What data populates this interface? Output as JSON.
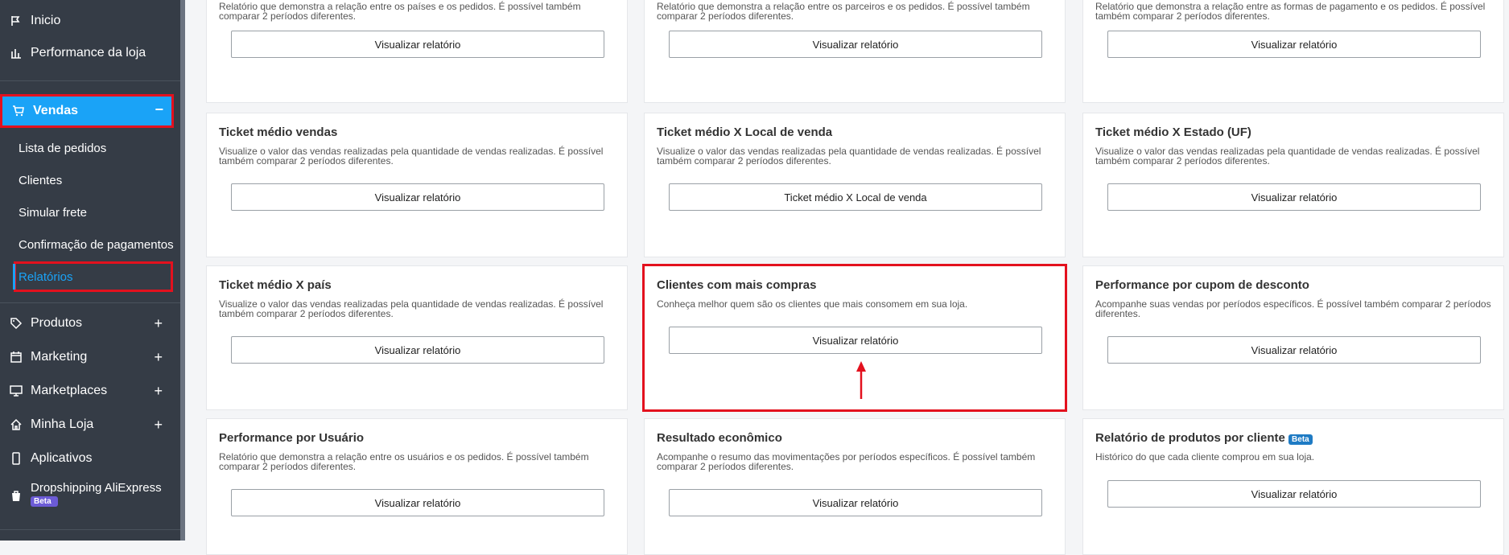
{
  "sidebar": {
    "items": [
      {
        "label": "Inicio",
        "icon": "flag-icon"
      },
      {
        "label": "Performance da loja",
        "icon": "bar-chart-icon"
      },
      {
        "label": "Vendas",
        "icon": "cart-icon",
        "expander": "−"
      },
      {
        "label": "Produtos",
        "icon": "tag-icon",
        "expander": "+"
      },
      {
        "label": "Marketing",
        "icon": "calendar-icon",
        "expander": "+"
      },
      {
        "label": "Marketplaces",
        "icon": "monitor-icon",
        "expander": "+"
      },
      {
        "label": "Minha Loja",
        "icon": "home-icon",
        "expander": "+"
      },
      {
        "label": "Aplicativos",
        "icon": "phone-icon"
      },
      {
        "label": "Dropshipping AliExpress",
        "icon": "bag-icon",
        "badge": "Beta"
      }
    ],
    "vendas_sub": [
      "Lista de pedidos",
      "Clientes",
      "Simular frete",
      "Confirmação de pagamentos",
      "Relatórios"
    ]
  },
  "cards": {
    "r0c0": {
      "title": "",
      "desc": "Relatório que demonstra a relação entre os países e os pedidos. É possível também comparar 2 períodos diferentes.",
      "button": "Visualizar relatório"
    },
    "r0c1": {
      "title": "",
      "desc": "Relatório que demonstra a relação entre os parceiros e os pedidos. É possível também comparar 2 períodos diferentes.",
      "button": "Visualizar relatório"
    },
    "r0c2": {
      "title": "",
      "desc": "Relatório que demonstra a relação entre as formas de pagamento e os pedidos. É possível também comparar 2 períodos diferentes.",
      "button": "Visualizar relatório"
    },
    "r1c0": {
      "title": "Ticket médio vendas",
      "desc": "Visualize o valor das vendas realizadas pela quantidade de vendas realizadas. É possível também comparar 2 períodos diferentes.",
      "button": "Visualizar relatório"
    },
    "r1c1": {
      "title": "Ticket médio X Local de venda",
      "desc": "Visualize o valor das vendas realizadas pela quantidade de vendas realizadas. É possível também comparar 2 períodos diferentes.",
      "button": "Ticket médio X Local de venda"
    },
    "r1c2": {
      "title": "Ticket médio X Estado (UF)",
      "desc": "Visualize o valor das vendas realizadas pela quantidade de vendas realizadas. É possível também comparar 2 períodos diferentes.",
      "button": "Visualizar relatório"
    },
    "r2c0": {
      "title": "Ticket médio X país",
      "desc": "Visualize o valor das vendas realizadas pela quantidade de vendas realizadas. É possível também comparar 2 períodos diferentes.",
      "button": "Visualizar relatório"
    },
    "r2c1": {
      "title": "Clientes com mais compras",
      "desc": "Conheça melhor quem são os clientes que mais consomem em sua loja.",
      "button": "Visualizar relatório"
    },
    "r2c2": {
      "title": "Performance por cupom de desconto",
      "desc": "Acompanhe suas vendas por períodos específicos. É possível também comparar 2 períodos diferentes.",
      "button": "Visualizar relatório"
    },
    "r3c0": {
      "title": "Performance por Usuário",
      "desc": "Relatório que demonstra a relação entre os usuários e os pedidos. É possível também comparar 2 períodos diferentes.",
      "button": "Visualizar relatório"
    },
    "r3c1": {
      "title": "Resultado econômico",
      "desc": "Acompanhe o resumo das movimentações por períodos específicos. É possível também comparar 2 períodos diferentes.",
      "button": "Visualizar relatório"
    },
    "r3c2": {
      "title": "Relatório de produtos por cliente",
      "badge": "Beta",
      "desc": "Histórico do que cada cliente comprou em sua loja.",
      "button": "Visualizar relatório"
    }
  },
  "colors": {
    "sidebar": "#353c46",
    "accent": "#1aa3f7",
    "highlight": "#e3111e"
  }
}
